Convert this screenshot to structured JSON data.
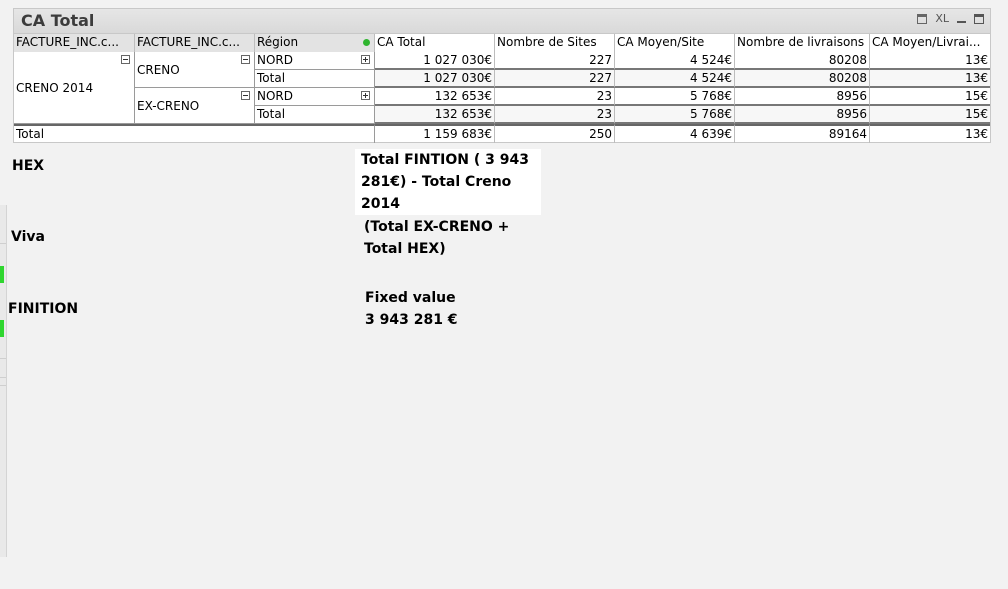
{
  "window": {
    "title": "CA Total",
    "xl_label": "XL"
  },
  "table": {
    "headers": [
      "FACTURE_INC.c...",
      "FACTURE_INC.c...",
      "Région",
      "CA Total",
      "Nombre de Sites",
      "CA Moyen/Site",
      "Nombre de livraisons",
      "CA Moyen/Livrai..."
    ],
    "group1": "CRENO 2014",
    "sub1": "CRENO",
    "sub2": "EX-CRENO",
    "rows": [
      {
        "region": "NORD",
        "ca": "1 027 030€",
        "sites": "227",
        "moy": "4 524€",
        "livr": "80208",
        "moyl": "13€"
      },
      {
        "region": "Total",
        "ca": "1 027 030€",
        "sites": "227",
        "moy": "4 524€",
        "livr": "80208",
        "moyl": "13€"
      },
      {
        "region": "NORD",
        "ca": "132 653€",
        "sites": "23",
        "moy": "5 768€",
        "livr": "8956",
        "moyl": "15€"
      },
      {
        "region": "Total",
        "ca": "132 653€",
        "sites": "23",
        "moy": "5 768€",
        "livr": "8956",
        "moyl": "15€"
      }
    ],
    "total": {
      "label": "Total",
      "ca": "1 159 683€",
      "sites": "250",
      "moy": "4 639€",
      "livr": "89164",
      "moyl": "13€"
    }
  },
  "annotations": {
    "hex": "HEX",
    "viva": "Viva",
    "finition": "FINITION",
    "note1_line1": "Total FINTION ( 3 943",
    "note1_line2": "281€) - Total Creno",
    "note1_line3": "2014",
    "note2_line1": "(Total EX-CRENO +",
    "note2_line2": "Total HEX)",
    "note3_line1": "Fixed value",
    "note3_line2": "3 943 281 €"
  }
}
